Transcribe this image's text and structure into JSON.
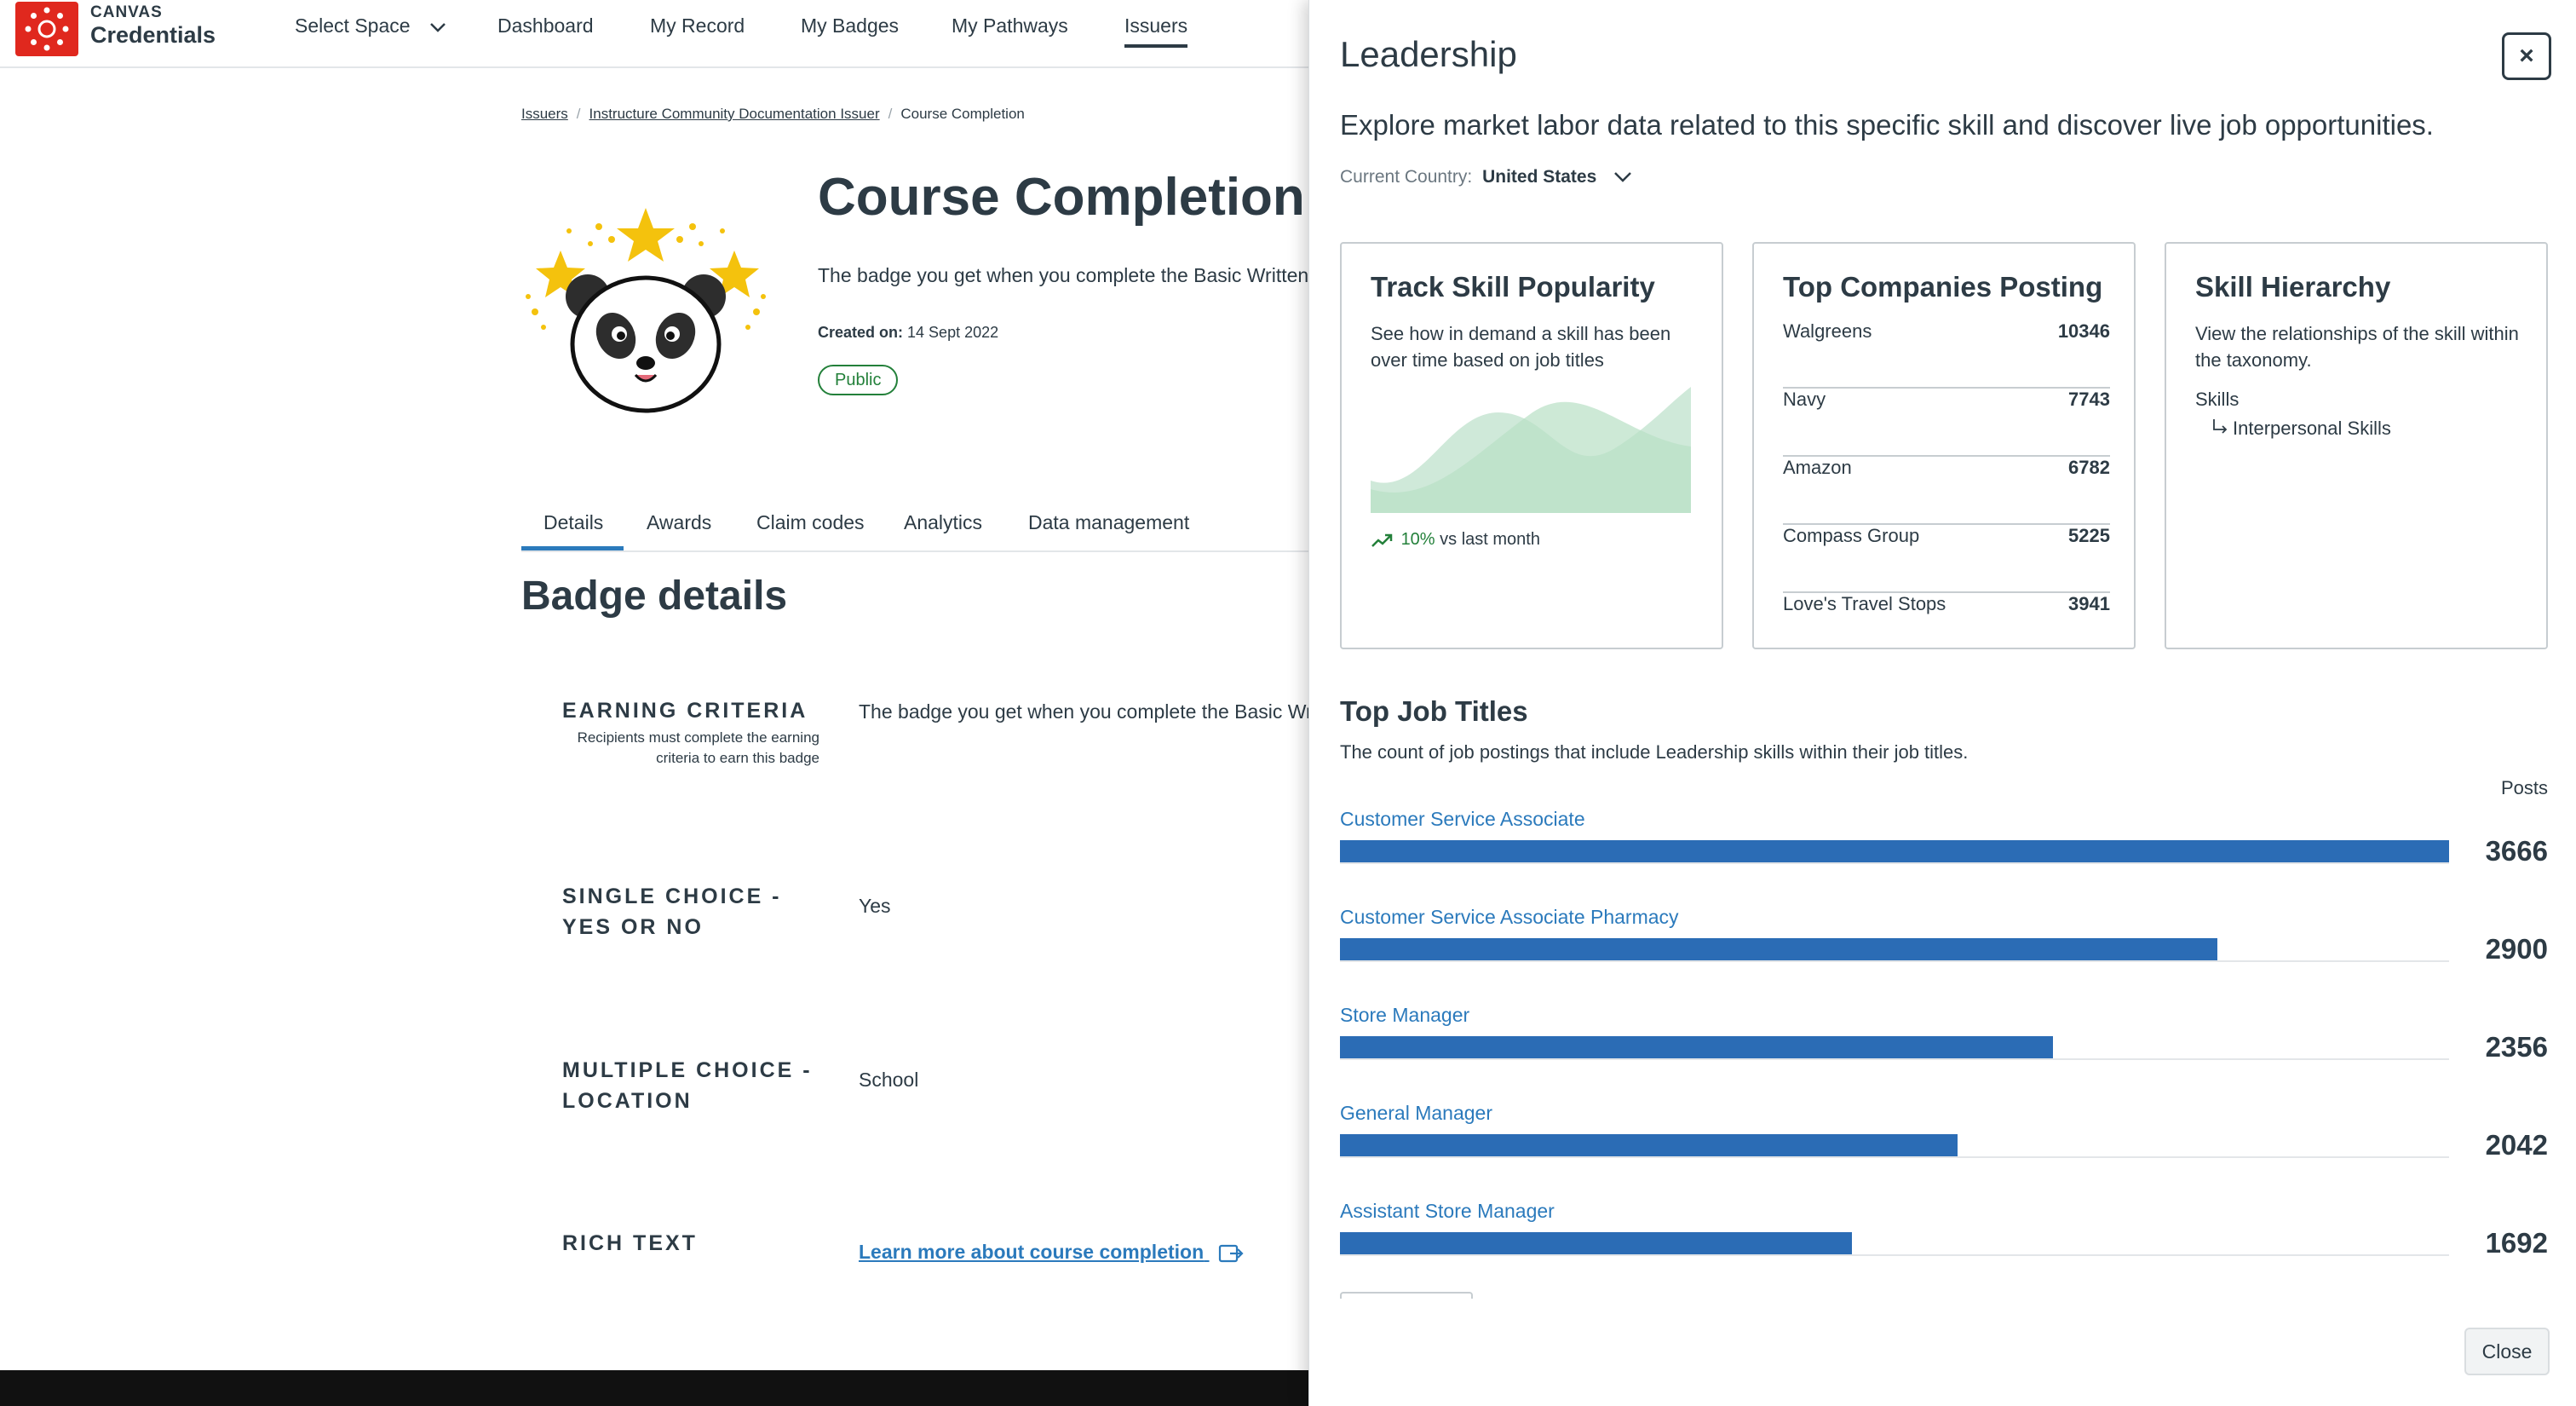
{
  "nav": {
    "brand_small": "CANVAS",
    "brand_big": "Credentials",
    "select_space": "Select Space",
    "items": [
      "Dashboard",
      "My Record",
      "My Badges",
      "My Pathways",
      "Issuers"
    ],
    "active": "Issuers"
  },
  "breadcrumb": [
    "Issuers",
    "Instructure Community Documentation Issuer",
    "Course Completion"
  ],
  "badge": {
    "title": "Course Completion",
    "description": "The badge you get when you complete the Basic Written",
    "created_label": "Created on:",
    "created_value": "14 Sept 2022",
    "visibility": "Public"
  },
  "tabs": [
    "Details",
    "Awards",
    "Claim codes",
    "Analytics",
    "Data management"
  ],
  "active_tab": "Details",
  "details": {
    "heading": "Badge details",
    "fields": [
      {
        "label": "EARNING CRITERIA",
        "sub": "Recipients must complete the earning criteria to earn this badge",
        "value": "The badge you get when you complete the Basic Written"
      },
      {
        "label": "SINGLE CHOICE - YES OR NO",
        "value": "Yes"
      },
      {
        "label": "MULTIPLE CHOICE - LOCATION",
        "value": "School"
      },
      {
        "label": "RICH TEXT",
        "value": "Learn more about course completion"
      }
    ]
  },
  "drawer": {
    "title": "Leadership",
    "intro": "Explore market labor data related to this specific skill and discover live job opportunities.",
    "country_label": "Current Country:",
    "country_value": "United States",
    "popularity": {
      "title": "Track Skill Popularity",
      "text": "See how in demand a skill has been over time based on job titles",
      "pct": "10%",
      "suffix": "vs last month",
      "trend_color": "#23803a"
    },
    "companies": {
      "title": "Top Companies Posting",
      "rows": [
        {
          "name": "Walgreens",
          "count": "10346"
        },
        {
          "name": "Navy",
          "count": "7743"
        },
        {
          "name": "Amazon",
          "count": "6782"
        },
        {
          "name": "Compass Group",
          "count": "5225"
        },
        {
          "name": "Love's Travel Stops",
          "count": "3941"
        }
      ]
    },
    "hierarchy": {
      "title": "Skill Hierarchy",
      "text": "View the relationships of the skill within the taxonomy.",
      "root": "Skills",
      "child": "Interpersonal Skills"
    },
    "jobs": {
      "title": "Top Job Titles",
      "subtitle": "The count of job postings that include Leadership skills within their job titles.",
      "posts_label": "Posts",
      "bar_color": "#2b6cb5",
      "rows": [
        {
          "name": "Customer Service Associate",
          "count": 3666
        },
        {
          "name": "Customer Service Associate Pharmacy",
          "count": 2900
        },
        {
          "name": "Store Manager",
          "count": 2356
        },
        {
          "name": "General Manager",
          "count": 2042
        },
        {
          "name": "Assistant Store Manager",
          "count": 1692
        }
      ]
    },
    "close_label": "Close",
    "close_x": "×"
  },
  "colors": {
    "brand_red": "#e0281e",
    "link_blue": "#2b7abc",
    "public_green": "#23803a"
  }
}
